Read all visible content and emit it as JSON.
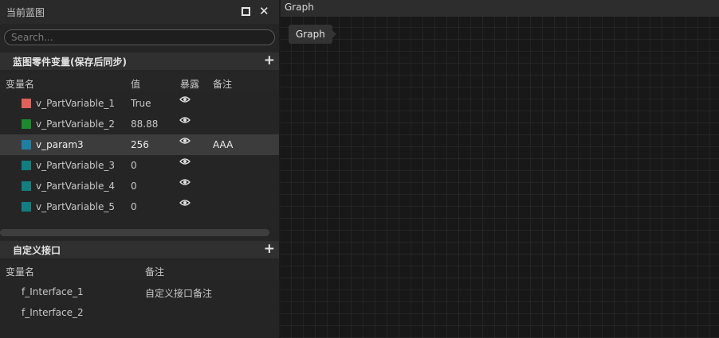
{
  "panel": {
    "title": "当前蓝图",
    "search_placeholder": "Search..."
  },
  "variables_section": {
    "title": "蓝图零件变量(保存后同步)",
    "columns": {
      "name": "变量名",
      "value": "值",
      "exposed": "暴露",
      "note": "备注"
    },
    "rows": [
      {
        "name": "v_PartVariable_1",
        "value": "True",
        "note": "",
        "color": "#e0605a"
      },
      {
        "name": "v_PartVariable_2",
        "value": "88.88",
        "note": "",
        "color": "#1e8a2e"
      },
      {
        "name": "v_param3",
        "value": "256",
        "note": "AAA",
        "color": "#1f7fa0"
      },
      {
        "name": "v_PartVariable_3",
        "value": "0",
        "note": "",
        "color": "#137e80"
      },
      {
        "name": "v_PartVariable_4",
        "value": "0",
        "note": "",
        "color": "#137e80"
      },
      {
        "name": "v_PartVariable_5",
        "value": "0",
        "note": "",
        "color": "#137e80"
      }
    ]
  },
  "interface_section": {
    "title": "自定义接口",
    "columns": {
      "name": "变量名",
      "note": "备注"
    },
    "rows": [
      {
        "name": "f_Interface_1",
        "note": "自定义接口备注"
      },
      {
        "name": "f_Interface_2",
        "note": ""
      }
    ]
  },
  "graph": {
    "tab_label": "Graph",
    "breadcrumb": "Graph"
  },
  "icons": {
    "maximize": "maximize-icon",
    "close": "close-icon",
    "add": "add-icon",
    "eye": "eye-icon"
  }
}
